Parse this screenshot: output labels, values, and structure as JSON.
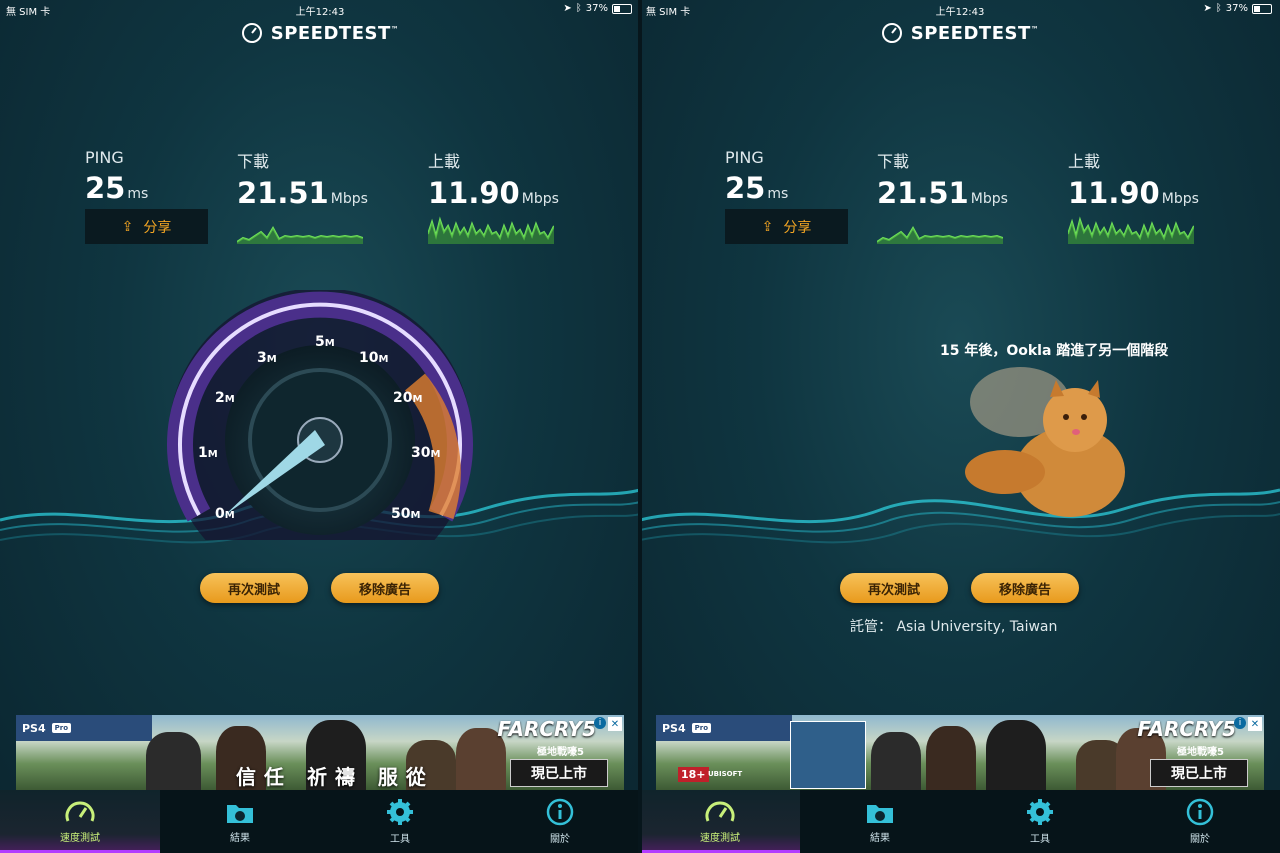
{
  "status": {
    "carrier": "無 SIM 卡",
    "time": "上午12:43",
    "battery": "37%",
    "battery_level": 0.37
  },
  "app": {
    "title": "SPEEDTEST",
    "trademark": "™"
  },
  "results": {
    "ping": {
      "label": "PING",
      "value": "25",
      "unit": "ms"
    },
    "download": {
      "label": "下載",
      "value": "21.51",
      "unit": "Mbps"
    },
    "upload": {
      "label": "上載",
      "value": "11.90",
      "unit": "Mbps"
    },
    "share_label": "分享"
  },
  "gauge": {
    "tick_labels": [
      "0",
      "1",
      "2",
      "3",
      "5",
      "10",
      "20",
      "30",
      "50"
    ],
    "tick_unit": "M",
    "needle_value_mbps": 1.0
  },
  "buttons": {
    "retest": "再次測試",
    "remove_ads": "移除廣告"
  },
  "promo": {
    "title": "15 年後，Ookla 踏進了另一個階段"
  },
  "host": {
    "label": "託管：",
    "value": "Asia University, Taiwan"
  },
  "ad": {
    "platform": "PS4",
    "platform_badge": "Pro",
    "brand": "FARCRY5",
    "subtitle": "極地戰嚎5",
    "slogan": "信任 祈禱 服從",
    "cta": "現已上市",
    "rating": "18+",
    "publisher": "UBISOFT"
  },
  "tabs": [
    {
      "label": "速度測試",
      "icon": "speedometer-icon",
      "active": true
    },
    {
      "label": "結果",
      "icon": "folder-icon",
      "active": false
    },
    {
      "label": "工具",
      "icon": "gear-icon",
      "active": false
    },
    {
      "label": "關於",
      "icon": "info-icon",
      "active": false
    }
  ],
  "colors": {
    "accent": "#f4a623",
    "spark": "#6ee05a",
    "active_tab": "#c8f07a",
    "tab_underline": "#b23cff"
  }
}
